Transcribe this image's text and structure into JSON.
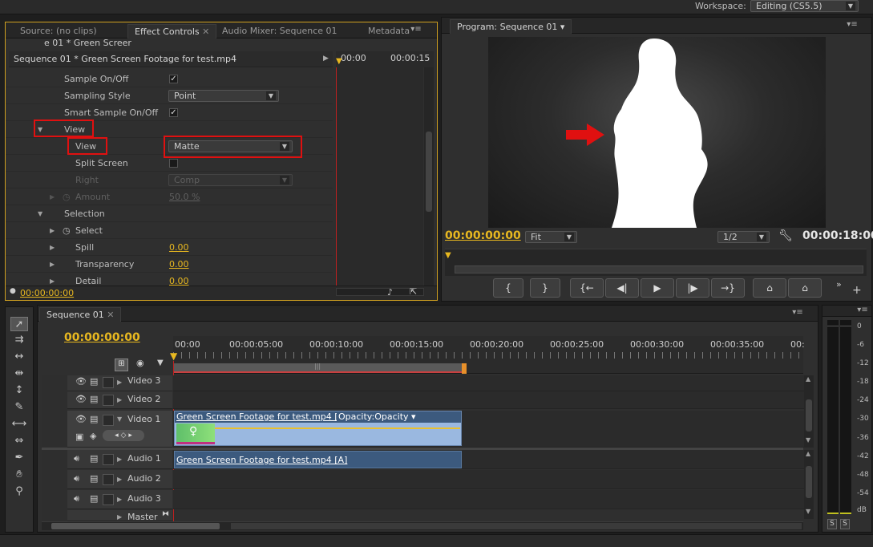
{
  "topbar": {
    "workspace_label": "Workspace:",
    "workspace_value": "Editing (CS5.5)"
  },
  "effect_panel": {
    "tabs": [
      "Source: (no clips)",
      "Effect Controls",
      "Audio Mixer: Sequence 01",
      "Metadata"
    ],
    "breadcrumb": "e 01 * Green Screer",
    "clip_header": "Sequence 01 * Green Screen Footage for test.mp4",
    "ruler_start": "00:00",
    "ruler_end": "00:00:15",
    "rows": {
      "sample_onoff": "Sample On/Off",
      "sampling_style": "Sampling Style",
      "sampling_style_value": "Point",
      "smart_sample": "Smart Sample On/Off",
      "view_group": "View",
      "view": "View",
      "view_value": "Matte",
      "split_screen": "Split Screen",
      "right": "Right",
      "right_value": "Comp",
      "amount": "Amount",
      "amount_value": "50.0 %",
      "selection": "Selection",
      "select": "Select",
      "spill": "Spill",
      "spill_value": "0.00",
      "transparency": "Transparency",
      "transparency_value": "0.00",
      "detail": "Detail",
      "detail_value": "0.00"
    },
    "timecode": "00:00:00:00"
  },
  "program": {
    "tab": "Program: Sequence 01",
    "timecode": "00:00:00:00",
    "fit": "Fit",
    "resolution": "1/2",
    "duration": "00:00:18:00",
    "buttons": [
      "{",
      "}",
      "{←",
      "◀|",
      "▶",
      "|▶",
      "→}",
      "⌂",
      "⌂"
    ]
  },
  "sequence": {
    "tab": "Sequence 01",
    "timecode": "00:00:00:00",
    "ruler": [
      "00:00",
      "00:00:05:00",
      "00:00:10:00",
      "00:00:15:00",
      "00:00:20:00",
      "00:00:25:00",
      "00:00:30:00",
      "00:00:35:00",
      "00:"
    ],
    "tracks": {
      "video3": "Video 3",
      "video2": "Video 2",
      "video1": "Video 1",
      "audio1": "Audio 1",
      "audio2": "Audio 2",
      "audio3": "Audio 3",
      "master": "Master"
    },
    "video_clip": "Green Screen Footage for test.mp4 [V]",
    "opacity_label": "Opacity:Opacity",
    "audio_clip": "Green Screen Footage for test.mp4 [A]"
  },
  "meter": {
    "scale": [
      "0",
      "-6",
      "-12",
      "-18",
      "-24",
      "-30",
      "-36",
      "-42",
      "-48",
      "-54",
      "dB"
    ],
    "solo_left": "S",
    "solo_right": "S"
  },
  "colors": {
    "timecode": "#e8b820",
    "highlight": "#e01010",
    "video_clip": "#9ab8e0",
    "audio_clip": "#3c5a7e"
  }
}
